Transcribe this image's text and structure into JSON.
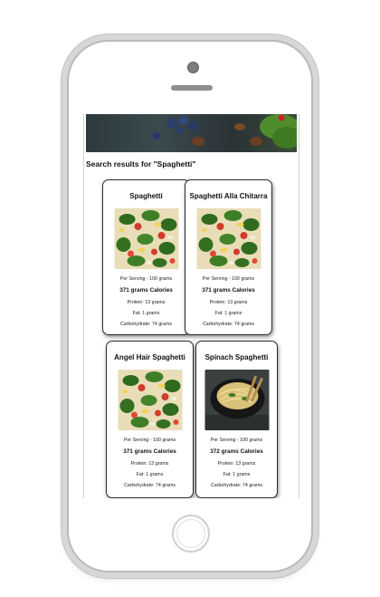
{
  "page": {
    "search_heading": "Search results for \"Spaghetti\""
  },
  "results": [
    {
      "name": "Spaghetti",
      "serving": "Per Serving - 100 grams",
      "calories": "371 grams Calories",
      "protein": "Protein: 13 grams",
      "fat": "Fat: 1 grams",
      "carbohydrate": "Carbohydrate: 74 grams"
    },
    {
      "name": "Spaghetti Alla Chitarra",
      "serving": "Per Serving - 100 grams",
      "calories": "371 grams Calories",
      "protein": "Protein: 13 grams",
      "fat": "Fat: 1 grams",
      "carbohydrate": "Carbohydrate: 74 grams"
    },
    {
      "name": "Angel Hair Spaghetti",
      "serving": "Per Serving - 100 grams",
      "calories": "371 grams Calories",
      "protein": "Protein: 13 grams",
      "fat": "Fat: 1 grams",
      "carbohydrate": "Carbohydrate: 74 grams"
    },
    {
      "name": "Spinach Spaghetti",
      "serving": "Per Serving - 100 grams",
      "calories": "372 grams Calories",
      "protein": "Protein: 13 grams",
      "fat": "Fat: 1 grams",
      "carbohydrate": "Carbohydrate: 74 grams"
    }
  ]
}
